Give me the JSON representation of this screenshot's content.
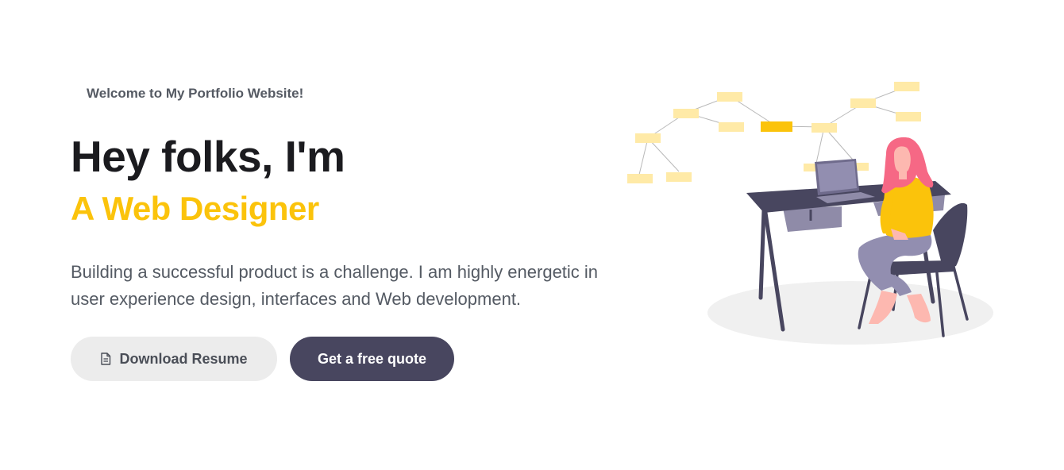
{
  "hero": {
    "welcome_text": "Welcome to My Portfolio Website!",
    "headline": "Hey folks, I'm",
    "subheadline": "A Web Designer",
    "description": "Building a successful product is a challenge. I am highly energetic in user experience design, interfaces and Web development.",
    "buttons": {
      "resume_label": "Download Resume",
      "resume_icon": "file-icon",
      "quote_label": "Get a free quote"
    }
  },
  "illustration": {
    "name": "woman-working-at-desk-illustration"
  },
  "colors": {
    "accent": "#fbc30b",
    "dark_button": "#48465f",
    "light_button": "#ececec",
    "heading": "#1b1b1f",
    "body_text": "#545a63"
  }
}
